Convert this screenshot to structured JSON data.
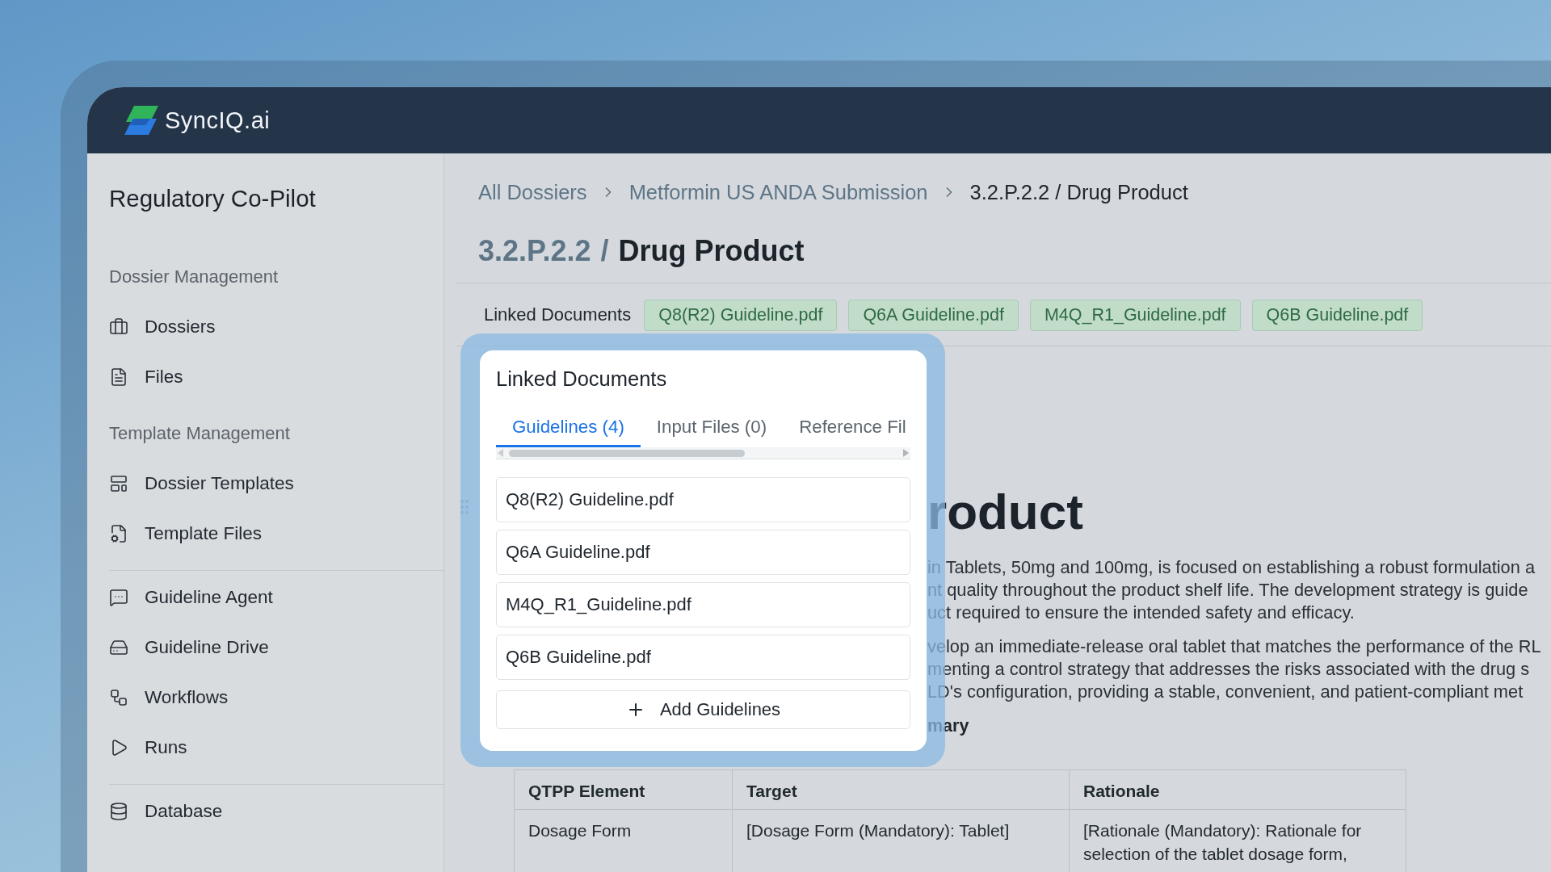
{
  "brand": {
    "name": "SyncIQ.ai"
  },
  "sidebar": {
    "title": "Regulatory Co-Pilot",
    "groups": [
      {
        "heading": "Dossier Management",
        "items": [
          {
            "label": "Dossiers"
          },
          {
            "label": "Files"
          }
        ]
      },
      {
        "heading": "Template Management",
        "items": [
          {
            "label": "Dossier Templates"
          },
          {
            "label": "Template Files"
          }
        ]
      },
      {
        "items": [
          {
            "label": "Guideline Agent"
          },
          {
            "label": "Guideline Drive"
          },
          {
            "label": "Workflows"
          },
          {
            "label": "Runs"
          }
        ]
      },
      {
        "items": [
          {
            "label": "Database"
          }
        ]
      }
    ]
  },
  "breadcrumb": [
    "All Dossiers",
    "Metformin US ANDA Submission",
    "3.2.P.2.2 / Drug Product"
  ],
  "page_title": {
    "code": "3.2.P.2.2",
    "separator": "/",
    "name": "Drug Product"
  },
  "linked_documents": {
    "label": "Linked Documents",
    "files": [
      "Q8(R2) Guideline.pdf",
      "Q6A Guideline.pdf",
      "M4Q_R1_Guideline.pdf",
      "Q6B Guideline.pdf"
    ]
  },
  "popup": {
    "title": "Linked Documents",
    "tabs": [
      {
        "label": "Guidelines (4)",
        "selected": true
      },
      {
        "label": "Input Files (0)",
        "selected": false
      },
      {
        "label": "Reference Fil",
        "selected": false
      }
    ],
    "files": [
      "Q8(R2) Guideline.pdf",
      "Q6A Guideline.pdf",
      "M4Q_R1_Guideline.pdf",
      "Q6B Guideline.pdf"
    ],
    "add_button": "Add Guidelines"
  },
  "document": {
    "heading": "roduct",
    "paragraphs": [
      [
        "in Tablets, 50mg and 100mg, is focused on establishing a robust formulation a",
        "nt quality throughout the product shelf life. The development strategy is guide",
        "uct required to ensure the intended safety and efficacy."
      ],
      [
        "velop an immediate-release oral tablet that matches the performance of the RL",
        "menting a control strategy that addresses the risks associated with the drug s",
        "LD's configuration, providing a stable, convenient, and patient-compliant met"
      ]
    ],
    "subheading": "mary"
  },
  "table": {
    "columns": [
      "QTPP Element",
      "Target",
      "Rationale"
    ],
    "rows": [
      [
        "Dosage Form",
        "[Dosage Form (Mandatory): Tablet]",
        "[Rationale (Mandatory): Rationale for selection of the tablet dosage form,"
      ]
    ]
  }
}
